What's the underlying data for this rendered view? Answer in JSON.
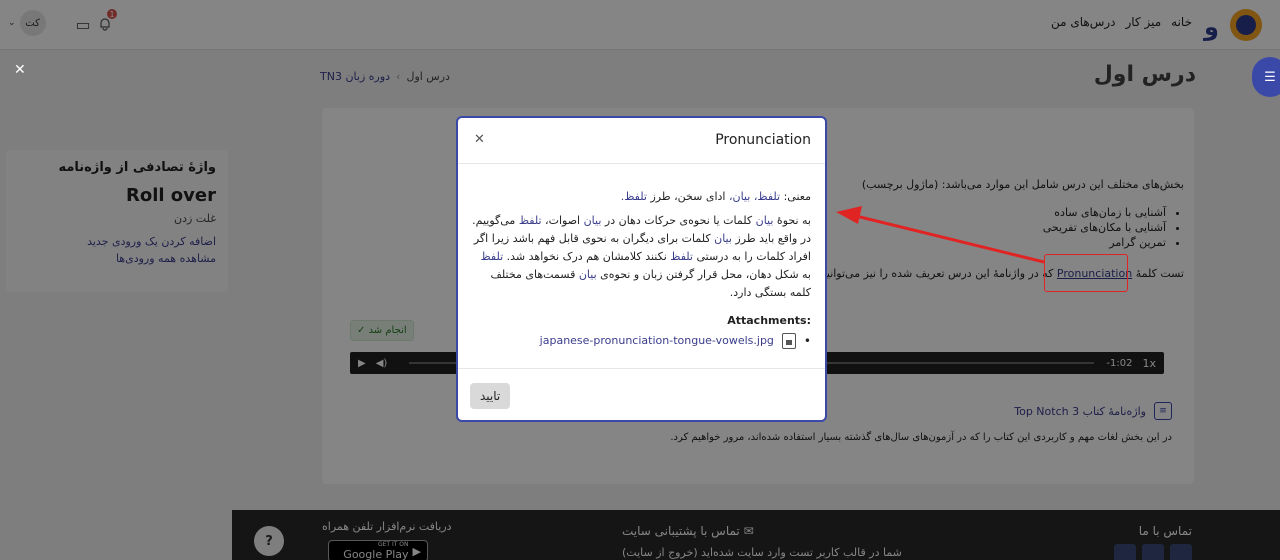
{
  "nav": {
    "links": [
      "خانه",
      "میز کار",
      "درس‌های من"
    ],
    "user_initials": "کت",
    "notification_count": "1"
  },
  "drawer": {
    "card_title": "واژهٔ تصادفی از واژه‌نامه",
    "word": "Roll over",
    "definition": "غلت زدن",
    "add_entry_link": "اضافه کردن یک ورودی جدید",
    "view_all_link": "مشاهده همه ورودی‌ها"
  },
  "header": {
    "page_title": "درس اول",
    "breadcrumb": [
      "دوره زبان TN3",
      "درس اول"
    ]
  },
  "content": {
    "intro": "بخش‌های مختلف این درس شامل این موارد می‌باشد: (ماژول برچسب)",
    "topics": [
      "آشنایی با زمان‌های ساده",
      "آشنایی با مکان‌های تفریحی",
      "تمرین گرامر"
    ],
    "test_prefix": "تست کلمهٔ",
    "test_word": "Pronunciation",
    "test_suffix": "که در واژنامهٔ این درس تعریف شده را نیز می‌توانید ببینید ... و فیلتر خودکار لینک‌دهی مربوط با آن لینک شده است.",
    "done_badge": "✓ انجام شد",
    "audio_time": "-1:02",
    "audio_speed": "1x",
    "book_link": "واژه‌نامهٔ کتاب Top Notch 3",
    "book_desc": "در این بخش لغات مهم و کاربردی این کتاب را که در آزمون‌های سال‌های گذشته بسیار استفاده شده‌اند، مرور خواهیم کرد."
  },
  "modal": {
    "title": "Pronunciation",
    "meaning_label": "معنی:",
    "meaning_terms": [
      "تلفظ،",
      "بیان،",
      "ادای سخن،",
      "طرز",
      "تلفظ."
    ],
    "paragraph": [
      {
        "t": "به نحوهٔ ",
        "h": false
      },
      {
        "t": "بیان",
        "h": true
      },
      {
        "t": " کلمات یا نحوه‌ی حرکات دهان در ",
        "h": false
      },
      {
        "t": "بیان",
        "h": true
      },
      {
        "t": " اصوات، ",
        "h": false
      },
      {
        "t": "تلفظ",
        "h": true
      },
      {
        "t": " می‌گوییم. در واقع باید طرز ",
        "h": false
      },
      {
        "t": "بیان",
        "h": true
      },
      {
        "t": " کلمات برای دیگران به نحوی قابل فهم باشد زیرا اگر افراد کلمات را به درستی ",
        "h": false
      },
      {
        "t": "تلفظ",
        "h": true
      },
      {
        "t": " نکنند کلامشان هم درک نخواهد شد. ",
        "h": false
      },
      {
        "t": "تلفظ",
        "h": true
      },
      {
        "t": " به شکل دهان، محل قرار گرفتن زبان و نحوه‌ی ",
        "h": false
      },
      {
        "t": "بیان",
        "h": true
      },
      {
        "t": " قسمت‌های مختلف کلمه بستگی دارد.",
        "h": false
      }
    ],
    "attachments_title": "Attachments:",
    "attachment_file": "japanese-pronunciation-tongue-vowels.jpg",
    "confirm_label": "تایید"
  },
  "footer": {
    "contact_title": "تماس با ما",
    "support": "تماس با پشتیبانی سایت",
    "login_note": "شما در قالب کاربر تست وارد سایت شده‌اید (خروج از سایت)",
    "app_title": "دریافت نرم‌افزار تلفن همراه",
    "gplay_small": "GET IT ON",
    "gplay_big": "Google Play",
    "help": "?"
  },
  "colors": {
    "brand": "#3a49a8",
    "link": "#3a3d8c",
    "annotation": "#e02424"
  }
}
